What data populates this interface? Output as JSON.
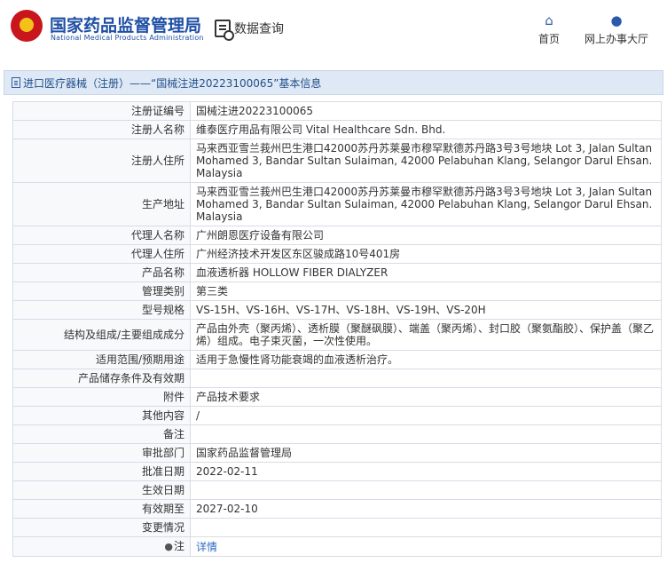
{
  "header": {
    "site_name": "国家药品监督管理局",
    "site_name_en": "National Medical Products Administration",
    "query_label": "数据查询",
    "nav": [
      {
        "label": "首页",
        "icon": "home-icon"
      },
      {
        "label": "网上办事大厅",
        "icon": "person-icon"
      }
    ]
  },
  "breadcrumb": {
    "text": "进口医疗器械（注册）——“国械注进20223100065”基本信息"
  },
  "details": [
    {
      "label": "注册证编号",
      "value": "国械注进20223100065"
    },
    {
      "label": "注册人名称",
      "value": "维泰医疗用品有限公司 Vital Healthcare Sdn. Bhd."
    },
    {
      "label": "注册人住所",
      "value": "马来西亚雪兰莪州巴生港口42000苏丹苏莱曼市穆罕默德苏丹路3号3号地块 Lot 3, Jalan Sultan Mohamed 3, Bandar Sultan Sulaiman, 42000 Pelabuhan Klang, Selangor Darul Ehsan.Malaysia"
    },
    {
      "label": "生产地址",
      "value": "马来西亚雪兰莪州巴生港口42000苏丹苏莱曼市穆罕默德苏丹路3号3号地块 Lot 3, Jalan Sultan Mohamed 3, Bandar Sultan Sulaiman, 42000 Pelabuhan Klang, Selangor Darul Ehsan.Malaysia"
    },
    {
      "label": "代理人名称",
      "value": "广州朗恩医疗设备有限公司"
    },
    {
      "label": "代理人住所",
      "value": "广州经济技术开发区东区骏成路10号401房"
    },
    {
      "label": "产品名称",
      "value": "血液透析器 HOLLOW FIBER DIALYZER"
    },
    {
      "label": "管理类别",
      "value": "第三类"
    },
    {
      "label": "型号规格",
      "value": "VS-15H、VS-16H、VS-17H、VS-18H、VS-19H、VS-20H"
    },
    {
      "label": "结构及组成/主要组成成分",
      "value": "产品由外壳（聚丙烯）、透析膜（聚醚砜膜）、端盖（聚丙烯）、封口胶（聚氨酯胶）、保护盖（聚乙烯）组成。电子束灭菌，一次性使用。"
    },
    {
      "label": "适用范围/预期用途",
      "value": "适用于急慢性肾功能衰竭的血液透析治疗。"
    },
    {
      "label": "产品储存条件及有效期",
      "value": ""
    },
    {
      "label": "附件",
      "value": "产品技术要求"
    },
    {
      "label": "其他内容",
      "value": "/"
    },
    {
      "label": "备注",
      "value": ""
    },
    {
      "label": "审批部门",
      "value": "国家药品监督管理局"
    },
    {
      "label": "批准日期",
      "value": "2022-02-11"
    },
    {
      "label": "生效日期",
      "value": ""
    },
    {
      "label": "有效期至",
      "value": "2027-02-10"
    },
    {
      "label": "变更情况",
      "value": ""
    },
    {
      "label": "注",
      "value": "详情"
    }
  ],
  "colors": {
    "brand": "#1f4fa5",
    "breadcrumb_bg": "#dfe9f5",
    "link": "#2a6bc2"
  }
}
